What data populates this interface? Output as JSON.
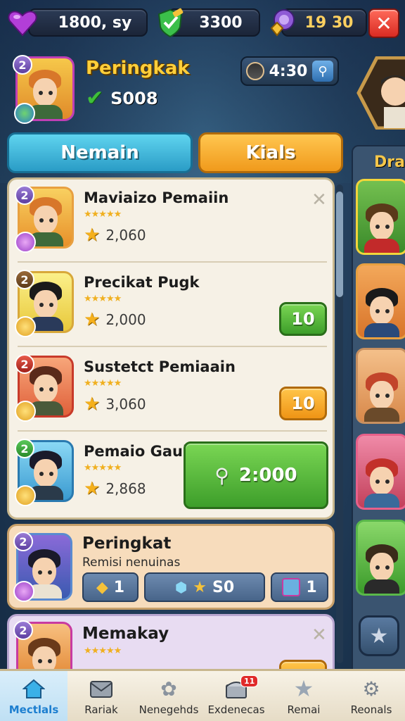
{
  "topbar": {
    "resource1": "1800, sy",
    "resource2": "3300",
    "resource3": "19 30",
    "close_label": "✕"
  },
  "header": {
    "level": "2",
    "title": "Peringkak",
    "check_value": "S008",
    "timer": "4:30"
  },
  "tabs": {
    "tab1": "Nemain",
    "tab2": "Kials"
  },
  "side": {
    "header": "Dral"
  },
  "list": [
    {
      "level": "2",
      "name": "Maviaizo Pemaiin",
      "score": "2,060"
    },
    {
      "level": "2",
      "name": "Precikat Pugk",
      "score": "2,000",
      "button": "10"
    },
    {
      "level": "2",
      "name": "Sustetct Pemiaain",
      "score": "3,060",
      "button": "10"
    },
    {
      "level": "2",
      "name": "Pemaio Gauk",
      "score": "2,868",
      "button": "2:000"
    }
  ],
  "feature": {
    "level": "2",
    "title": "Peringkat",
    "subtitle": "Remisi nenuinas",
    "slot1": "1",
    "slot2": "S0",
    "slot3": "1"
  },
  "feature2": {
    "level": "2",
    "title": "Memakay"
  },
  "nav": {
    "items": [
      {
        "label": "Mectlals",
        "icon": "home-icon"
      },
      {
        "label": "Rariak",
        "icon": "mail-icon"
      },
      {
        "label": "Nenegehds",
        "icon": "gear-icon"
      },
      {
        "label": "Exdenecas",
        "icon": "chest-icon",
        "badge": "11"
      },
      {
        "label": "Remai",
        "icon": "star-icon"
      },
      {
        "label": "Reonals",
        "icon": "settings-icon"
      }
    ]
  },
  "colors": {
    "accent_green": "#3d9e2a",
    "accent_orange": "#ef9415",
    "accent_blue": "#2a9cc6"
  }
}
